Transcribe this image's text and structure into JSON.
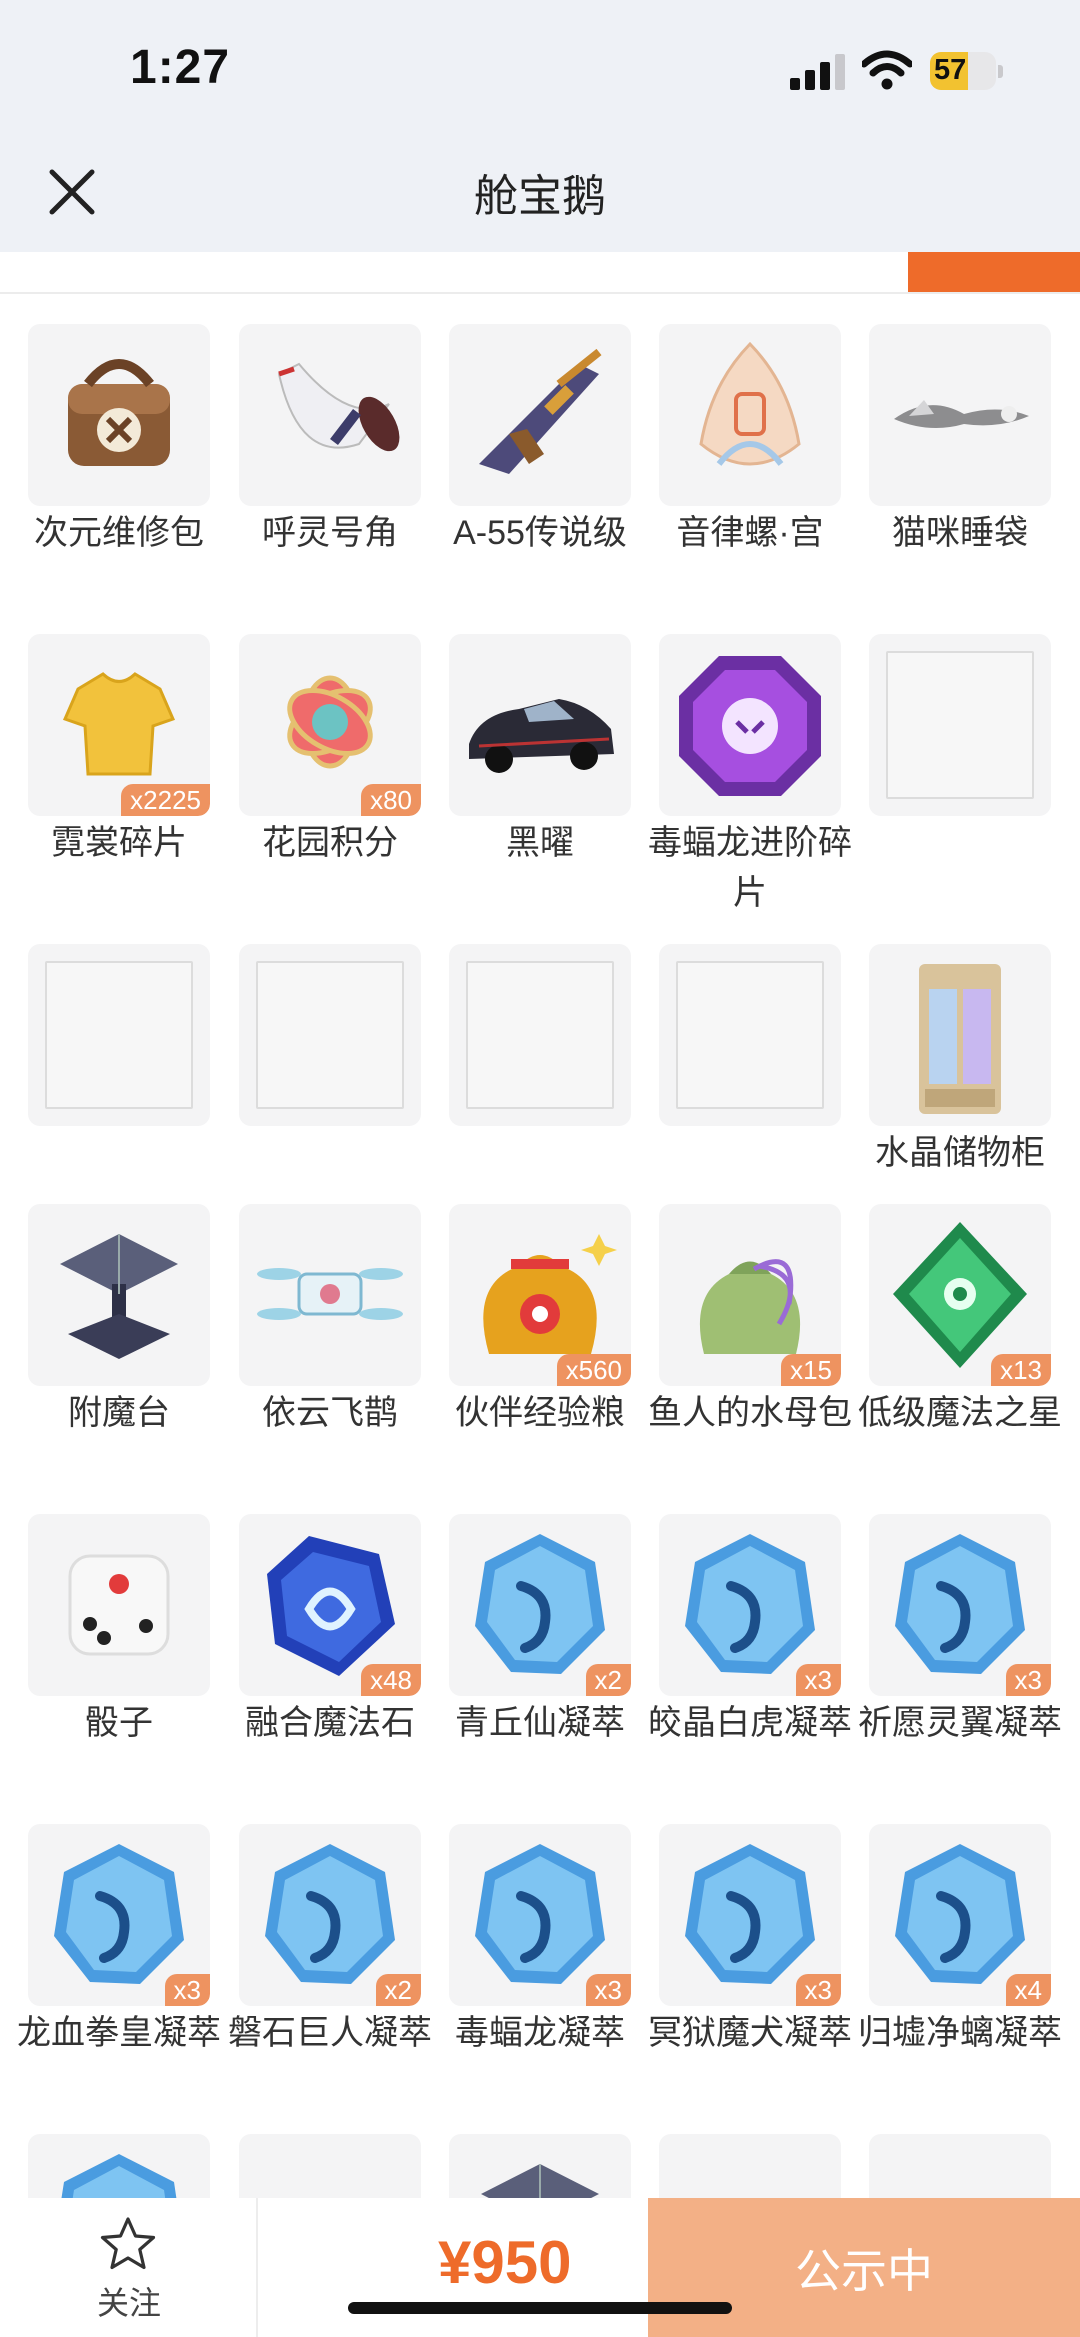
{
  "status_bar": {
    "time": "1:27",
    "battery": "57",
    "battery_level": 0.57
  },
  "nav": {
    "title": "舱宝鹅"
  },
  "items": [
    {
      "label": "次元维修包",
      "badge": "",
      "icon": "repair-bag-icon"
    },
    {
      "label": "呼灵号角",
      "badge": "",
      "icon": "horn-icon"
    },
    {
      "label": "A-55传说级",
      "badge": "",
      "icon": "rifle-icon"
    },
    {
      "label": "音律螺·宫",
      "badge": "",
      "icon": "conch-icon"
    },
    {
      "label": "猫咪睡袋",
      "badge": "",
      "icon": "cat-sleeping-bag-icon"
    },
    {
      "label": "霓裳碎片",
      "badge": "x2225",
      "icon": "shirt-fragment-icon"
    },
    {
      "label": "花园积分",
      "badge": "x80",
      "icon": "flower-token-icon"
    },
    {
      "label": "黑曜",
      "badge": "",
      "icon": "car-icon"
    },
    {
      "label": "毒蝠龙进阶碎片",
      "badge": "",
      "icon": "purple-gem-icon"
    },
    {
      "label": "",
      "badge": "",
      "icon": "placeholder-icon"
    },
    {
      "label": "",
      "badge": "",
      "icon": "placeholder-icon"
    },
    {
      "label": "",
      "badge": "",
      "icon": "placeholder-icon"
    },
    {
      "label": "",
      "badge": "",
      "icon": "placeholder-icon"
    },
    {
      "label": "",
      "badge": "",
      "icon": "placeholder-icon"
    },
    {
      "label": "水晶储物柜",
      "badge": "",
      "icon": "crystal-cabinet-icon"
    },
    {
      "label": "附魔台",
      "badge": "",
      "icon": "enchant-table-icon"
    },
    {
      "label": "依云飞鹊",
      "badge": "",
      "icon": "drone-icon"
    },
    {
      "label": "伙伴经验粮",
      "badge": "x560",
      "icon": "food-sack-icon"
    },
    {
      "label": "鱼人的水母包",
      "badge": "x15",
      "icon": "jellyfish-bag-icon"
    },
    {
      "label": "低级魔法之星",
      "badge": "x13",
      "icon": "green-gem-icon"
    },
    {
      "label": "骰子",
      "badge": "",
      "icon": "dice-icon"
    },
    {
      "label": "融合魔法石",
      "badge": "x48",
      "icon": "magic-stone-icon"
    },
    {
      "label": "青丘仙凝萃",
      "badge": "x2",
      "icon": "blue-crystal-icon"
    },
    {
      "label": "皎晶白虎凝萃",
      "badge": "x3",
      "icon": "blue-crystal-icon"
    },
    {
      "label": "祈愿灵翼凝萃",
      "badge": "x3",
      "icon": "blue-crystal-icon"
    },
    {
      "label": "龙血拳皇凝萃",
      "badge": "x3",
      "icon": "blue-crystal-icon"
    },
    {
      "label": "磐石巨人凝萃",
      "badge": "x2",
      "icon": "blue-crystal-icon"
    },
    {
      "label": "毒蝠龙凝萃",
      "badge": "x3",
      "icon": "blue-crystal-icon"
    },
    {
      "label": "冥狱魔犬凝萃",
      "badge": "x3",
      "icon": "blue-crystal-icon"
    },
    {
      "label": "归墟净螭凝萃",
      "badge": "x4",
      "icon": "blue-crystal-icon"
    },
    {
      "label": "",
      "badge": "",
      "icon": "blue-crystal-icon"
    },
    {
      "label": "",
      "badge": "",
      "icon": "brown-item-icon"
    },
    {
      "label": "",
      "badge": "",
      "icon": "enchant-table-icon"
    },
    {
      "label": "",
      "badge": "",
      "icon": "gold-item-icon"
    },
    {
      "label": "",
      "badge": "",
      "icon": "cloud-item-icon"
    }
  ],
  "bottom": {
    "follow_label": "关注",
    "follow_icon": "star-icon",
    "price": "¥950",
    "status": "公示中"
  },
  "colors": {
    "accent": "#ee6b2a",
    "badge": "#ee9360",
    "status_button": "#f3b086",
    "header_bg": "#eef1f6"
  }
}
